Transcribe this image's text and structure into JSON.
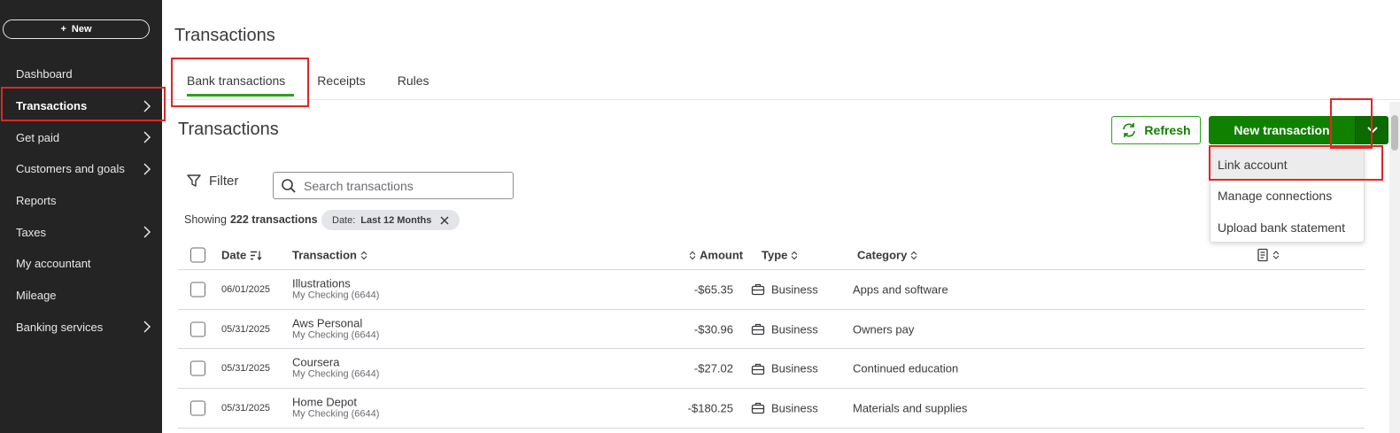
{
  "sidebar": {
    "new_label": "New",
    "items": [
      {
        "label": "Dashboard",
        "has_chevron": false
      },
      {
        "label": "Transactions",
        "has_chevron": true
      },
      {
        "label": "Get paid",
        "has_chevron": true
      },
      {
        "label": "Customers and goals",
        "has_chevron": true
      },
      {
        "label": "Reports",
        "has_chevron": false
      },
      {
        "label": "Taxes",
        "has_chevron": true
      },
      {
        "label": "My accountant",
        "has_chevron": false
      },
      {
        "label": "Mileage",
        "has_chevron": false
      },
      {
        "label": "Banking services",
        "has_chevron": true
      }
    ]
  },
  "header": {
    "title": "Transactions",
    "tabs": [
      {
        "label": "Bank transactions"
      },
      {
        "label": "Receipts"
      },
      {
        "label": "Rules"
      }
    ]
  },
  "section": {
    "title": "Transactions",
    "refresh_label": "Refresh",
    "new_transaction_label": "New transaction",
    "dropdown_items": [
      {
        "label": "Link account"
      },
      {
        "label": "Manage connections"
      },
      {
        "label": "Upload bank statement"
      }
    ]
  },
  "filters": {
    "filter_label": "Filter",
    "search_placeholder": "Search transactions",
    "showing_prefix": "Showing",
    "showing_count": "222 transactions",
    "chip_key": "Date:",
    "chip_value": "Last 12 Months"
  },
  "table": {
    "headers": {
      "date": "Date",
      "transaction": "Transaction",
      "amount": "Amount",
      "type": "Type",
      "category": "Category"
    },
    "rows": [
      {
        "date": "06/01/2025",
        "name": "Illustrations",
        "account": "My Checking (6644)",
        "amount": "-$65.35",
        "type": "Business",
        "category": "Apps and software"
      },
      {
        "date": "05/31/2025",
        "name": "Aws Personal",
        "account": "My Checking (6644)",
        "amount": "-$30.96",
        "type": "Business",
        "category": "Owners pay"
      },
      {
        "date": "05/31/2025",
        "name": "Coursera",
        "account": "My Checking (6644)",
        "amount": "-$27.02",
        "type": "Business",
        "category": "Continued education"
      },
      {
        "date": "05/31/2025",
        "name": "Home Depot",
        "account": "My Checking (6644)",
        "amount": "-$180.25",
        "type": "Business",
        "category": "Materials and supplies"
      }
    ]
  },
  "colors": {
    "sidebar_bg": "#242424",
    "brand_green": "#108000",
    "highlight_red": "#e02626"
  },
  "icons": [
    "plus-icon",
    "chevron-right-icon",
    "refresh-icon",
    "chevron-down-icon",
    "filter-icon",
    "search-icon",
    "close-icon",
    "sort-icon",
    "briefcase-icon",
    "receipt-icon"
  ]
}
